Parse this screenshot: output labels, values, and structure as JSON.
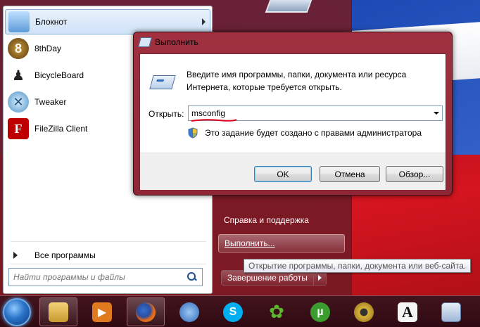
{
  "start_menu": {
    "programs": [
      {
        "label": "Блокнот",
        "icon": "notepad-icon",
        "color": "#7fb6e8"
      },
      {
        "label": "8thDay",
        "icon": "8thday-icon",
        "color": "#6a4a1a"
      },
      {
        "label": "BicycleBoard",
        "icon": "bicycleboard-icon",
        "color": "#222222"
      },
      {
        "label": "Tweaker",
        "icon": "tweaker-icon",
        "color": "#3a8fc8"
      },
      {
        "label": "FileZilla Client",
        "icon": "filezilla-icon",
        "color": "#bf0000"
      }
    ],
    "all_programs": "Все программы",
    "search_placeholder": "Найти программы и файлы",
    "right_items": {
      "help": "Справка и поддержка",
      "run": "Выполнить..."
    },
    "shutdown": "Завершение работы"
  },
  "tooltip": "Открытие программы, папки, документа или веб-сайта.",
  "run_dialog": {
    "title": "Выполнить",
    "description": "Введите имя программы, папки, документа или ресурса Интернета, которые требуется открыть.",
    "open_label": "Открыть:",
    "open_value": "msconfig",
    "admin_note": "Это задание будет создано с правами администратора",
    "ok": "OK",
    "cancel": "Отмена",
    "browse": "Обзор..."
  },
  "taskbar": {
    "items": [
      {
        "name": "explorer-icon",
        "glyph": "",
        "color": "#e3b54a"
      },
      {
        "name": "media-player-icon",
        "glyph": "▶",
        "color": "#e07a1f"
      },
      {
        "name": "firefox-icon",
        "glyph": "",
        "color": "#e2661a"
      },
      {
        "name": "thunderbird-icon",
        "glyph": "",
        "color": "#2f6bb8"
      },
      {
        "name": "skype-icon",
        "glyph": "S",
        "color": "#00aff0"
      },
      {
        "name": "icq-icon",
        "glyph": "✿",
        "color": "#5bb82e"
      },
      {
        "name": "utorrent-icon",
        "glyph": "µ",
        "color": "#3b9c2f"
      },
      {
        "name": "webcam-icon",
        "glyph": "",
        "color": "#d9b43a"
      },
      {
        "name": "font-app-icon",
        "glyph": "A",
        "color": "#f5f5f5"
      },
      {
        "name": "calculator-icon",
        "glyph": "",
        "color": "#9fb7d8"
      }
    ]
  },
  "colors": {
    "underline_red": "#e0001b",
    "accent_blue": "#3c7fb1"
  }
}
